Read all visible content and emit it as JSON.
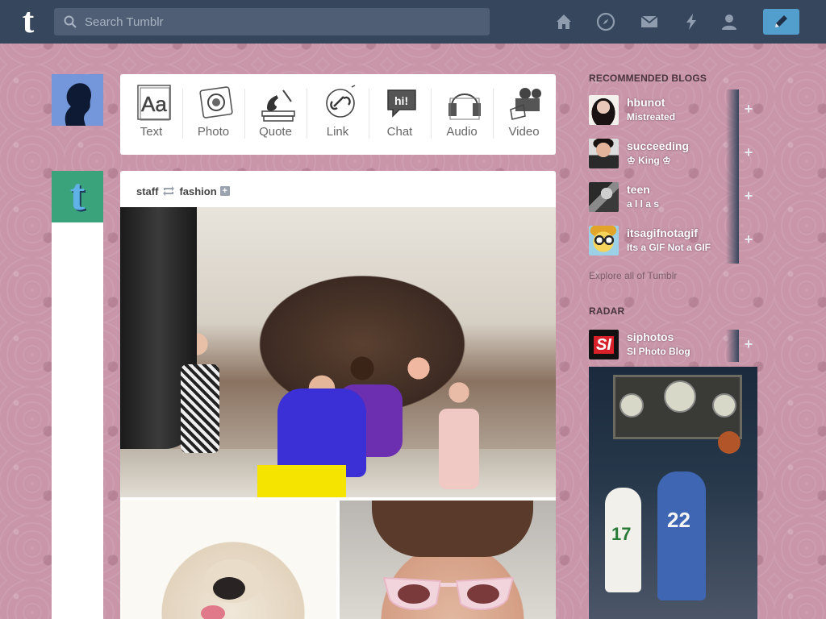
{
  "header": {
    "logo": "t",
    "search_placeholder": "Search Tumblr",
    "nav_icons": [
      "home-icon",
      "explore-compass-icon",
      "inbox-mail-icon",
      "activity-lightning-icon",
      "account-person-icon"
    ],
    "compose_icon": "pencil-icon"
  },
  "post_types": [
    {
      "label": "Text",
      "icon": "text-aa-icon"
    },
    {
      "label": "Photo",
      "icon": "photo-camera-icon"
    },
    {
      "label": "Quote",
      "icon": "quote-icon"
    },
    {
      "label": "Link",
      "icon": "link-icon"
    },
    {
      "label": "Chat",
      "icon": "chat-bubble-icon"
    },
    {
      "label": "Audio",
      "icon": "audio-headphones-icon"
    },
    {
      "label": "Video",
      "icon": "video-camera-icon"
    }
  ],
  "post": {
    "author": "staff",
    "reblogged_from": "fashion",
    "follow_icon": "plus-icon"
  },
  "sidebar": {
    "recommended_title": "RECOMMENDED BLOGS",
    "recommended": [
      {
        "name": "hbunot",
        "subtitle": "Mistreated"
      },
      {
        "name": "succeeding",
        "subtitle": "♔ King ♔"
      },
      {
        "name": "teen",
        "subtitle": "a l l a s"
      },
      {
        "name": "itsagifnotagif",
        "subtitle": "Its a GIF Not a GIF"
      }
    ],
    "explore_link": "Explore all of Tumblr",
    "radar_title": "RADAR",
    "radar": {
      "name": "siphotos",
      "subtitle": "SI Photo Blog",
      "avatar_text": "SI"
    }
  },
  "colors": {
    "header_bg": "#36465d",
    "compose_bg": "#529ecc",
    "background": "#c896a8"
  }
}
